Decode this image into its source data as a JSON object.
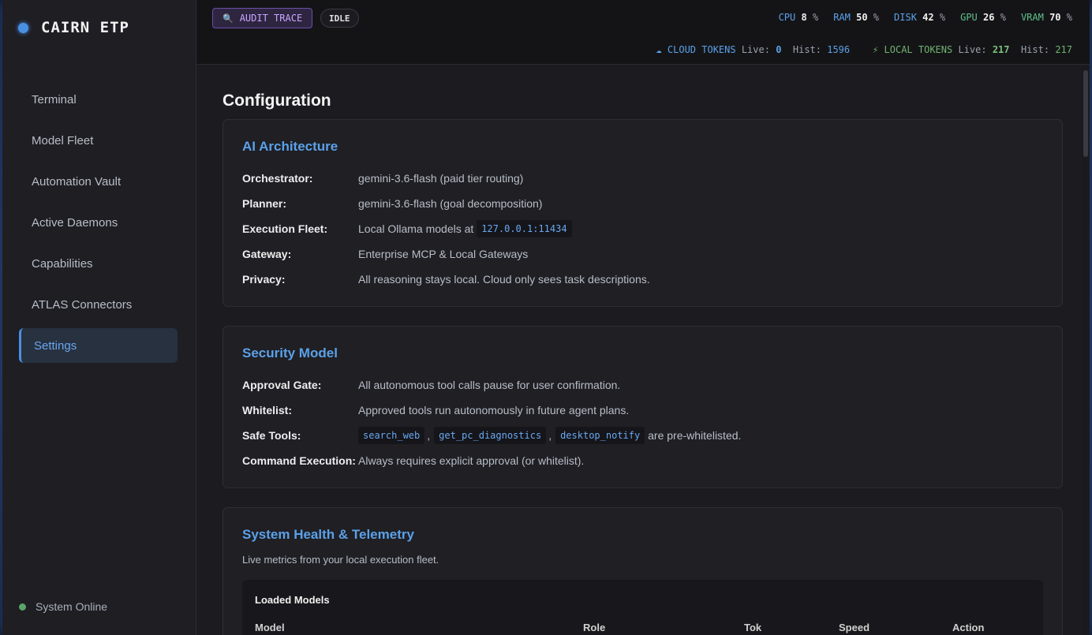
{
  "app": {
    "name": "CAIRN ETP"
  },
  "sidebar": {
    "items": [
      {
        "label": "Terminal"
      },
      {
        "label": "Model Fleet"
      },
      {
        "label": "Automation Vault"
      },
      {
        "label": "Active Daemons"
      },
      {
        "label": "Capabilities"
      },
      {
        "label": "ATLAS Connectors"
      },
      {
        "label": "Settings",
        "active": true
      }
    ],
    "status": "System Online"
  },
  "topbar": {
    "audit_label": "AUDIT TRACE",
    "idle_label": "IDLE",
    "metrics": [
      {
        "key": "CPU",
        "value": "8",
        "unit": "%"
      },
      {
        "key": "RAM",
        "value": "50",
        "unit": "%"
      },
      {
        "key": "DISK",
        "value": "42",
        "unit": "%"
      },
      {
        "key": "GPU",
        "value": "26",
        "unit": "%"
      },
      {
        "key": "VRAM",
        "value": "70",
        "unit": "%"
      }
    ],
    "cloud_tokens": {
      "label": "CLOUD TOKENS",
      "live_label": "Live:",
      "live": "0",
      "hist_label": "Hist:",
      "hist": "1596"
    },
    "local_tokens": {
      "label": "LOCAL TOKENS",
      "live_label": "Live:",
      "live": "217",
      "hist_label": "Hist:",
      "hist": "217"
    }
  },
  "page": {
    "title": "Configuration",
    "ai": {
      "title": "AI Architecture",
      "rows": [
        {
          "label": "Orchestrator:",
          "value": "gemini-3.6-flash (paid tier routing)"
        },
        {
          "label": "Planner:",
          "value": "gemini-3.6-flash (goal decomposition)"
        },
        {
          "label": "Execution Fleet:",
          "value": "Local Ollama models at",
          "code": "127.0.0.1:11434"
        },
        {
          "label": "Gateway:",
          "value": "Enterprise MCP & Local Gateways"
        },
        {
          "label": "Privacy:",
          "value": "All reasoning stays local. Cloud only sees task descriptions."
        }
      ]
    },
    "security": {
      "title": "Security Model",
      "rows": [
        {
          "label": "Approval Gate:",
          "value": "All autonomous tool calls pause for user confirmation."
        },
        {
          "label": "Whitelist:",
          "value": "Approved tools run autonomously in future agent plans."
        },
        {
          "label": "Safe Tools:",
          "codes": [
            "search_web",
            "get_pc_diagnostics",
            "desktop_notify"
          ],
          "suffix": "are pre-whitelisted."
        },
        {
          "label": "Command Execution:",
          "value": "Always requires explicit approval (or whitelist)."
        }
      ],
      "sep": ","
    },
    "health": {
      "title": "System Health & Telemetry",
      "desc": "Live metrics from your local execution fleet.",
      "loaded_title": "Loaded Models",
      "columns": [
        "Model",
        "Role",
        "Tok",
        "Speed",
        "Action"
      ]
    }
  },
  "colors": {
    "accent": "#5ba1e8",
    "purple": "#c9a6ff",
    "green": "#5fc08a"
  }
}
